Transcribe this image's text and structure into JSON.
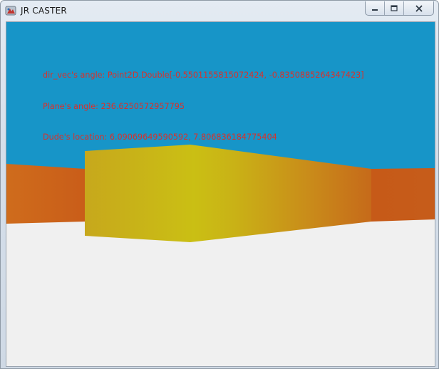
{
  "window": {
    "title": "JR CASTER",
    "icons": {
      "app": "jr-caster-app-icon",
      "minimize": "minimize-icon",
      "maximize": "maximize-icon",
      "close": "close-icon"
    }
  },
  "scene": {
    "colors": {
      "sky": "#1795c8",
      "floor": "#f0f0f0",
      "distant_wall": "#c85a1a",
      "near_wall_edge": "#c49a1a",
      "near_wall_center": "#c9bf14",
      "near_wall_right": "#c66d1a",
      "debug_text": "#d8312b"
    }
  },
  "debug": {
    "line1": "dir_vec's angle: Point2D.Double[-0.5501155815072424, -0.8350885264347423]",
    "line2": "Plane's angle: 236.6250572957795",
    "line3": "Dude's location: 6.09069649590592, 7.806836184775404"
  }
}
